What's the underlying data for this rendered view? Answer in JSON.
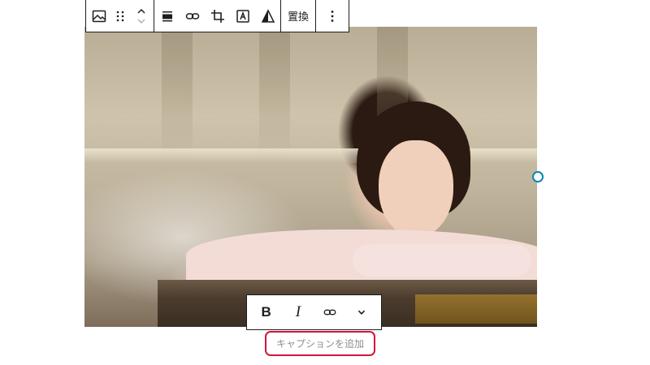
{
  "toolbar": {
    "replace_label": "置換",
    "icons": {
      "image": "image-icon",
      "drag": "drag-handle-icon",
      "move_up": "chevron-up-icon",
      "move_down": "chevron-down-icon",
      "align": "align-icon",
      "link": "link-icon",
      "crop": "crop-icon",
      "text_overlay": "text-overlay-icon",
      "duotone": "duotone-icon",
      "more": "more-options-icon"
    }
  },
  "caption_toolbar": {
    "bold_label": "B",
    "italic_label": "I",
    "icons": {
      "link": "link-icon",
      "more": "chevron-down-icon"
    }
  },
  "caption": {
    "placeholder": "キャプションを追加"
  },
  "colors": {
    "caption_highlight": "#d0153c",
    "handle": "#0f85b7",
    "toolbar_border": "#1e1e1e"
  }
}
